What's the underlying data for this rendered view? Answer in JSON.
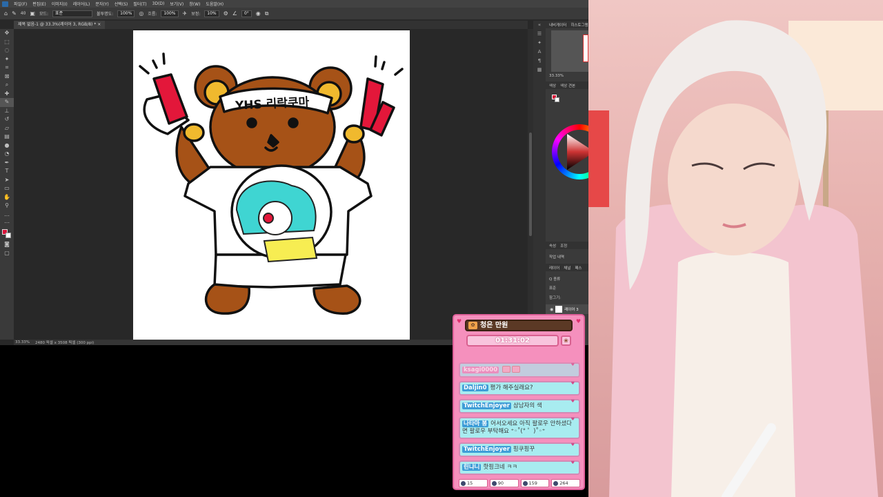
{
  "menu": [
    "파일(F)",
    "편집(E)",
    "이미지(I)",
    "레이어(L)",
    "문자(Y)",
    "선택(S)",
    "필터(T)",
    "3D(D)",
    "보기(V)",
    "창(W)",
    "도움말(H)"
  ],
  "options": {
    "brush_size": "40",
    "mode_label": "모드:",
    "mode_value": "표준",
    "opacity_label": "불투명도:",
    "opacity_value": "100%",
    "flow_label": "흐름:",
    "flow_value": "100%",
    "smooth_label": "보정:",
    "smooth_value": "10%",
    "angle_value": "0°"
  },
  "document": {
    "tab_title": "제목 없음-1 @ 33.3%(레이어 3, RGB/8) *",
    "canvas_text": "YHS 리락쿠마"
  },
  "status": {
    "zoom": "33.33%",
    "doc_info": "2480 픽셀 x 3508 픽셀 (300 ppi)"
  },
  "right_panel": {
    "nav_tabs": [
      "내비게이터",
      "히스토그램"
    ],
    "zoom": "33.33%",
    "color_tabs": [
      "색상",
      "색상 견본"
    ],
    "prop_tabs": [
      "속성",
      "조정"
    ],
    "history": "작업 내역",
    "layer_tabs": [
      "레이어",
      "채널",
      "패스"
    ],
    "kind": "Q 종류",
    "blend": "표준",
    "lock": "잠그기:",
    "layer_name": "레이어 3"
  },
  "chat": {
    "title": "청은 만원",
    "timer": "01:31:02",
    "messages": [
      {
        "user": "ksagi0000",
        "text": ""
      },
      {
        "user": "Daljin0",
        "text": "평가 해주실래요?"
      },
      {
        "user": "TwitchEnjoyer",
        "text": "삼남자의 색"
      },
      {
        "user": "나타마 봉",
        "text": "어서오세요 아직 팔로우 안하셨다면 팔로우 부탁해요  ⁺◦˚(° ゜)˚◦⁺"
      },
      {
        "user": "TwitchEnjoyer",
        "text": "핑쿠핑꾸"
      },
      {
        "user": "린냐니",
        "text": "핫핑크네 ㅋㅋ"
      }
    ],
    "stats": [
      "15",
      "90",
      "159",
      "264"
    ]
  },
  "colors": {
    "foreground": "#d8153a",
    "chat_bg": "#f590bd",
    "chat_msg": "#a8ecf0",
    "title_bg": "#5b3925"
  },
  "icons": [
    "home-icon",
    "brush-icon",
    "airbrush-icon",
    "angle-icon",
    "settings-icon",
    "heart-icon",
    "pet-icon"
  ]
}
